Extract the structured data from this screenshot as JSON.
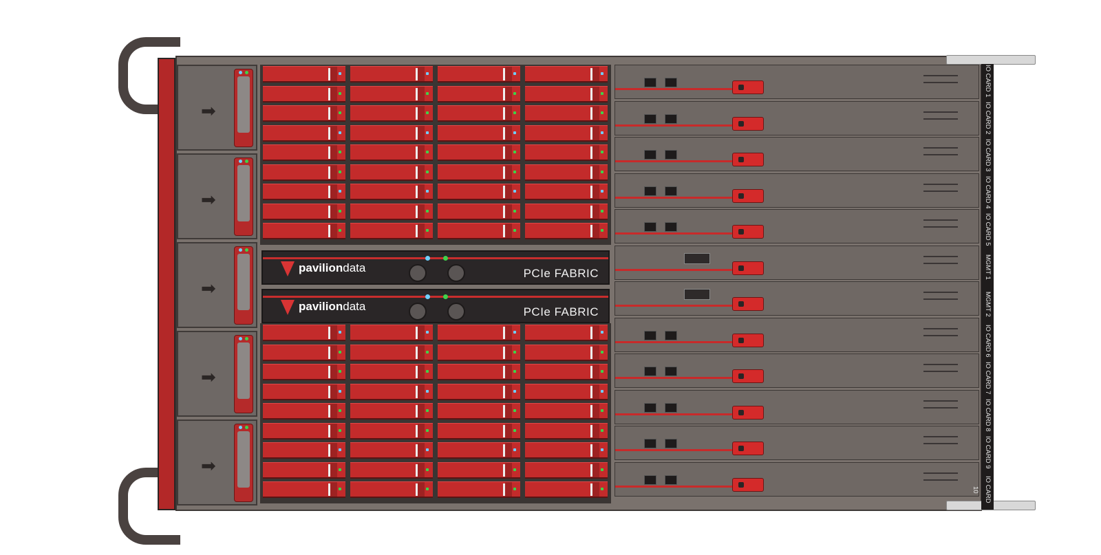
{
  "brand": {
    "name_bold": "pavilion",
    "name_thin": "data"
  },
  "fabric_modules": [
    {
      "label": "PCIe FABRIC"
    },
    {
      "label": "PCIe FABRIC"
    }
  ],
  "io_slots": [
    {
      "label": "IO CARD 1"
    },
    {
      "label": "IO CARD 2"
    },
    {
      "label": "IO CARD 3"
    },
    {
      "label": "IO CARD 4"
    },
    {
      "label": "IO CARD 5"
    },
    {
      "label": "MGMT 1"
    },
    {
      "label": "MGMT 2"
    },
    {
      "label": "IO CARD 6"
    },
    {
      "label": "IO CARD 7"
    },
    {
      "label": "IO CARD 8"
    },
    {
      "label": "IO CARD 9"
    },
    {
      "label": "IO CARD 10"
    }
  ],
  "psu_count": 5,
  "colors": {
    "accent_red": "#c32b2b",
    "chassis": "#7a726d",
    "led_green": "#3fd24a",
    "led_blue": "#6fd0ff"
  }
}
